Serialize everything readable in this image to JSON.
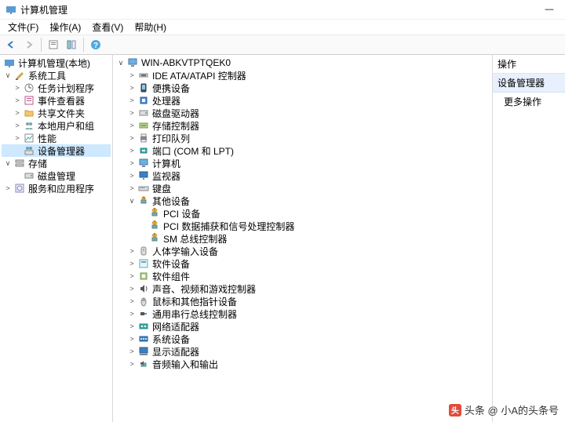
{
  "window_title": "计算机管理",
  "menu": {
    "file": "文件(F)",
    "action": "操作(A)",
    "view": "查看(V)",
    "help": "帮助(H)"
  },
  "toolbar_icons": {
    "back": "←",
    "forward": "→"
  },
  "left_tree": {
    "root": "计算机管理(本地)",
    "n0": "系统工具",
    "n00": "任务计划程序",
    "n01": "事件查看器",
    "n02": "共享文件夹",
    "n03": "本地用户和组",
    "n04": "性能",
    "n05": "设备管理器",
    "n1": "存储",
    "n10": "磁盘管理",
    "n2": "服务和应用程序"
  },
  "center_tree": {
    "root": "WIN-ABKVTPTQEK0",
    "c0": "IDE ATA/ATAPI 控制器",
    "c1": "便携设备",
    "c2": "处理器",
    "c3": "磁盘驱动器",
    "c4": "存储控制器",
    "c5": "打印队列",
    "c6": "端口 (COM 和 LPT)",
    "c7": "计算机",
    "c8": "监视器",
    "c9": "键盘",
    "c10": "其他设备",
    "c10a": "PCI 设备",
    "c10b": "PCI 数据捕获和信号处理控制器",
    "c10c": "SM 总线控制器",
    "c11": "人体学输入设备",
    "c12": "软件设备",
    "c13": "软件组件",
    "c14": "声音、视频和游戏控制器",
    "c15": "鼠标和其他指针设备",
    "c16": "通用串行总线控制器",
    "c17": "网络适配器",
    "c18": "系统设备",
    "c19": "显示适配器",
    "c20": "音频输入和输出"
  },
  "right": {
    "header": "操作",
    "group": "设备管理器",
    "more": "更多操作"
  },
  "watermark": "头条 @ 小A的头条号",
  "twist": {
    "open": "∨",
    "closed": ">"
  }
}
